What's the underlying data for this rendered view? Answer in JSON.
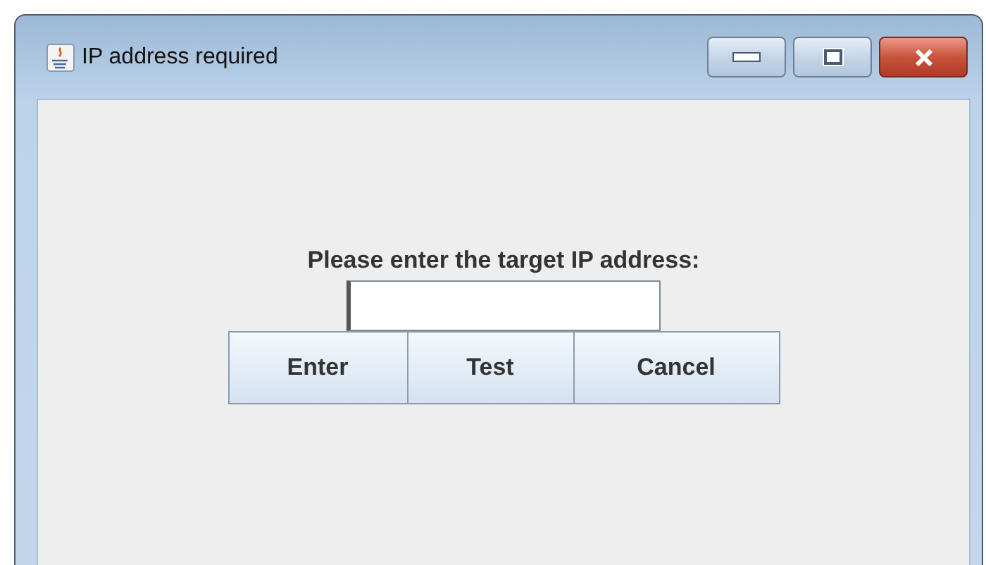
{
  "window": {
    "title": "IP address required"
  },
  "prompt": {
    "label": "Please enter the target IP address:"
  },
  "buttons": [
    {
      "label": "Enter"
    },
    {
      "label": "Test"
    },
    {
      "label": "Cancel"
    }
  ]
}
